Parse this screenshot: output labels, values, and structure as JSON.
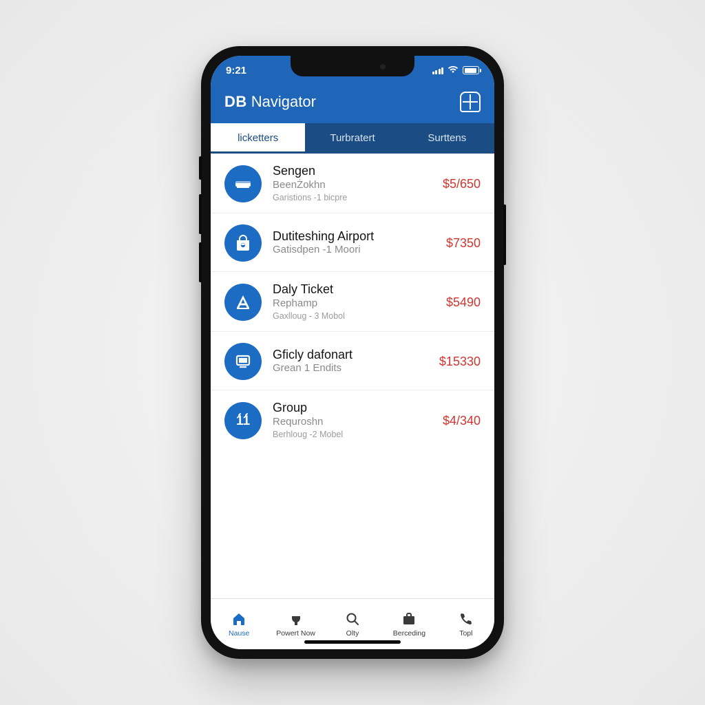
{
  "status": {
    "time": "9:21"
  },
  "header": {
    "logo": "DB",
    "title": "Navigator"
  },
  "tabs": [
    {
      "label": "licketters",
      "active": true
    },
    {
      "label": "Turbratert",
      "active": false
    },
    {
      "label": "Surttens",
      "active": false
    }
  ],
  "items": [
    {
      "icon": "train-icon",
      "title": "Sengen",
      "sub1": "BeenŻokhn",
      "sub2": "Garistions -1 bicpre",
      "price": "$5/650"
    },
    {
      "icon": "bag-icon",
      "title": "Dutiteshing Airport",
      "sub1": "Gatisdpen -1 Moori",
      "sub2": "",
      "price": "$7350"
    },
    {
      "icon": "letter-a-icon",
      "title": "Daly Ticket",
      "sub1": "Rephamp",
      "sub2": "Gaxlloug - 3 Mobol",
      "price": "$5490"
    },
    {
      "icon": "monitor-icon",
      "title": "Gficly dafonart",
      "sub1": "Grean 1 Endits",
      "sub2": "",
      "price": "$15330"
    },
    {
      "icon": "number-11-icon",
      "title": "Group",
      "sub1": "Requroshn",
      "sub2": "Berhloug -2 Mobel",
      "price": "$4/340"
    }
  ],
  "nav": [
    {
      "icon": "home-icon",
      "label": "Nause",
      "active": true
    },
    {
      "icon": "plug-icon",
      "label": "Powert Now",
      "active": false
    },
    {
      "icon": "search-icon",
      "label": "Olty",
      "active": false
    },
    {
      "icon": "briefcase-icon",
      "label": "Berceding",
      "active": false
    },
    {
      "icon": "phone-icon",
      "label": "Topl",
      "active": false
    }
  ],
  "colors": {
    "brand_blue": "#1f66b8",
    "tab_dark": "#1b4c83",
    "icon_blue": "#1c6cc4",
    "price_red": "#d0362f"
  }
}
